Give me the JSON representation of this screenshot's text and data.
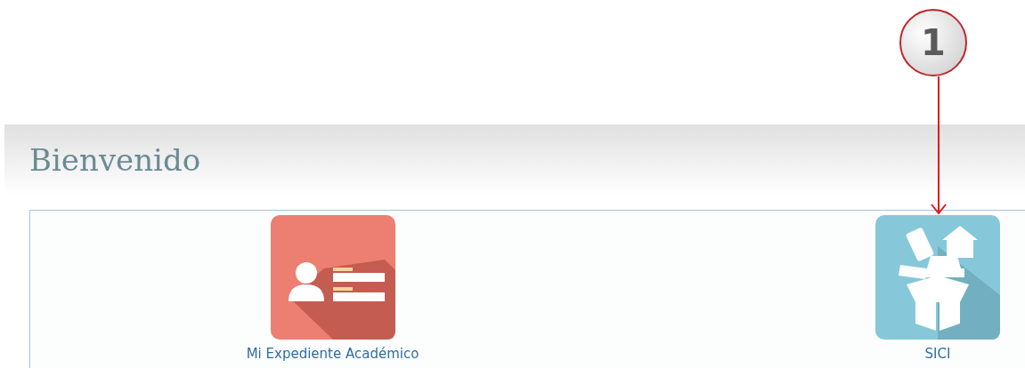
{
  "header": {
    "title": "Bienvenido"
  },
  "apps": [
    {
      "label": "Mi Expediente Académico",
      "kind": "record"
    },
    {
      "label": "SICI",
      "kind": "inventory"
    }
  ],
  "callout": {
    "number": "1"
  }
}
